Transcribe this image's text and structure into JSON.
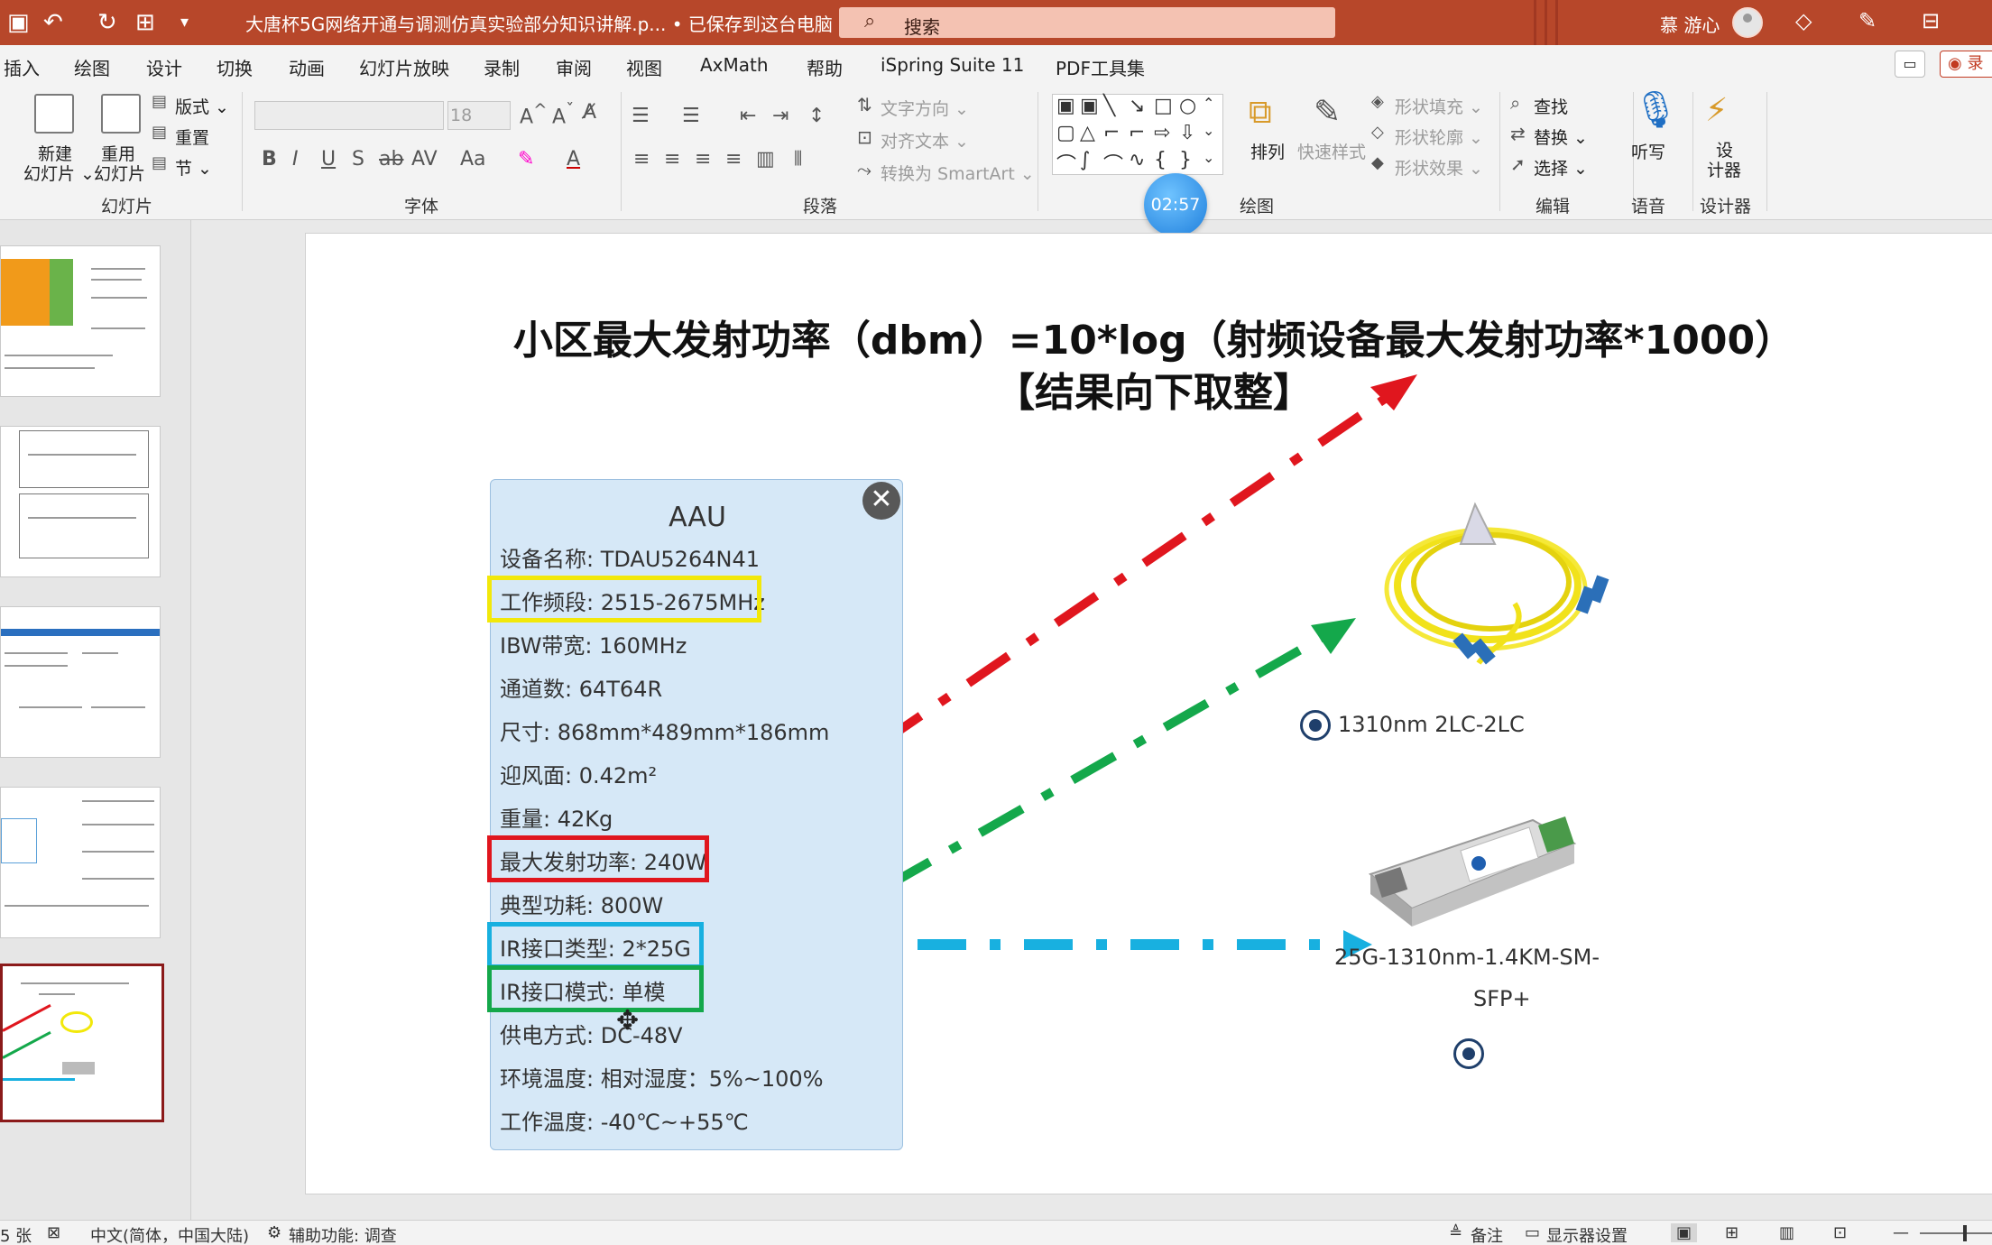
{
  "titlebar": {
    "doc_title": "大唐杯5G网络开通与调测仿真实验部分知识讲解.p... • 已保存到这台电脑 ⌄",
    "search_placeholder": "搜索",
    "user": "慕 游心",
    "accent": "#b7472a"
  },
  "menu": {
    "tabs": [
      "插入",
      "绘图",
      "设计",
      "切换",
      "动画",
      "幻灯片放映",
      "录制",
      "审阅",
      "视图",
      "AxMath",
      "帮助",
      "iSpring Suite 11",
      "PDF工具集"
    ],
    "record": "录"
  },
  "ribbon": {
    "slides": {
      "new_slide": "新建",
      "new_slide_sub": "幻灯片 ⌄",
      "reuse": "重用",
      "reuse_sub": "幻灯片",
      "layout": "版式 ⌄",
      "reset": "重置",
      "section": "节 ⌄",
      "label": "幻灯片"
    },
    "font": {
      "size": "18",
      "label": "字体"
    },
    "paragraph": {
      "text_direction": "文字方向 ⌄",
      "align_text": "对齐文本 ⌄",
      "smartart": "转换为 SmartArt ⌄",
      "label": "段落"
    },
    "drawing": {
      "arrange": "排列",
      "quick_styles": "快速样式",
      "fill": "形状填充 ⌄",
      "outline": "形状轮廓 ⌄",
      "effects": "形状效果 ⌄",
      "label": "绘图"
    },
    "editing": {
      "find": "查找",
      "replace": "替换 ⌄",
      "select": "选择 ⌄",
      "label": "编辑"
    },
    "voice": {
      "dictate": "听写",
      "label": "语音"
    },
    "designer": {
      "design": "设",
      "design2": "计器",
      "label": "设计器"
    },
    "timer": "02:57"
  },
  "slide": {
    "formula_line1": "小区最大发射功率（dbm）=10*log（射频设备最大发射功率*1000）",
    "formula_line2": "【结果向下取整】",
    "aau": {
      "title": "AAU",
      "close": "✕",
      "specs": [
        "设备名称: TDAU5264N41",
        "工作频段: 2515-2675MHz",
        "IBW带宽: 160MHz",
        "通道数: 64T64R",
        "尺寸: 868mm*489mm*186mm",
        "迎风面: 0.42m²",
        "重量: 42Kg",
        "最大发射功率: 240W",
        "典型功耗: 800W",
        "IR接口类型: 2*25G",
        "IR接口模式: 单模",
        "供电方式: DC-48V",
        "环境温度: 相对湿度：5%~100%",
        "工作温度: -40℃~+55℃"
      ]
    },
    "fiber_label": "1310nm 2LC-2LC",
    "sfp_label_1": "25G-1310nm-1.4KM-SM-",
    "sfp_label_2": "SFP+",
    "colors": {
      "red": "#e0161e",
      "green": "#14a84b",
      "blue": "#18b0e0",
      "yellow": "#f2e80a"
    }
  },
  "statusbar": {
    "slide_count": "5 张",
    "language": "中文(简体，中国大陆)",
    "accessibility": "辅助功能: 调查",
    "notes": "备注",
    "display": "显示器设置"
  }
}
